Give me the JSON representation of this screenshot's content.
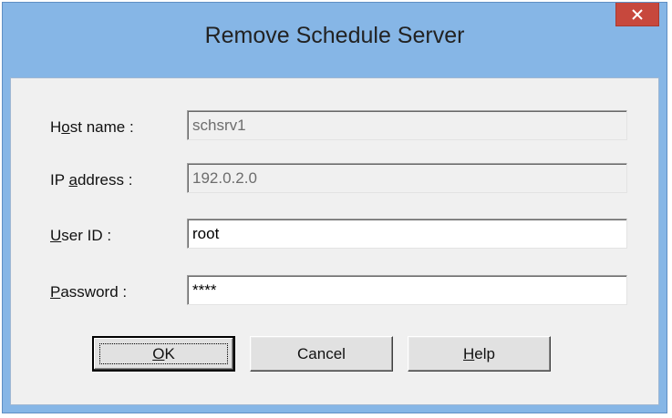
{
  "window": {
    "title": "Remove Schedule Server"
  },
  "form": {
    "host_name": {
      "label_prefix": "H",
      "label_underlined": "o",
      "label_suffix": "st name :",
      "value": "schsrv1"
    },
    "ip_address": {
      "label_prefix": "IP ",
      "label_underlined": "a",
      "label_suffix": "ddress :",
      "value": "192.0.2.0"
    },
    "user_id": {
      "label_prefix": "",
      "label_underlined": "U",
      "label_suffix": "ser ID :",
      "value": "root"
    },
    "password": {
      "label_prefix": "",
      "label_underlined": "P",
      "label_suffix": "assword :",
      "value": "****"
    }
  },
  "buttons": {
    "ok": {
      "prefix": "",
      "underlined": "O",
      "suffix": "K"
    },
    "cancel": {
      "label": "Cancel"
    },
    "help": {
      "prefix": "",
      "underlined": "H",
      "suffix": "elp"
    }
  },
  "colors": {
    "titlebar": "#86b6e6",
    "close_button": "#c7483d",
    "client_background": "#f0f0f0"
  },
  "icons": {
    "close": "close-icon"
  }
}
